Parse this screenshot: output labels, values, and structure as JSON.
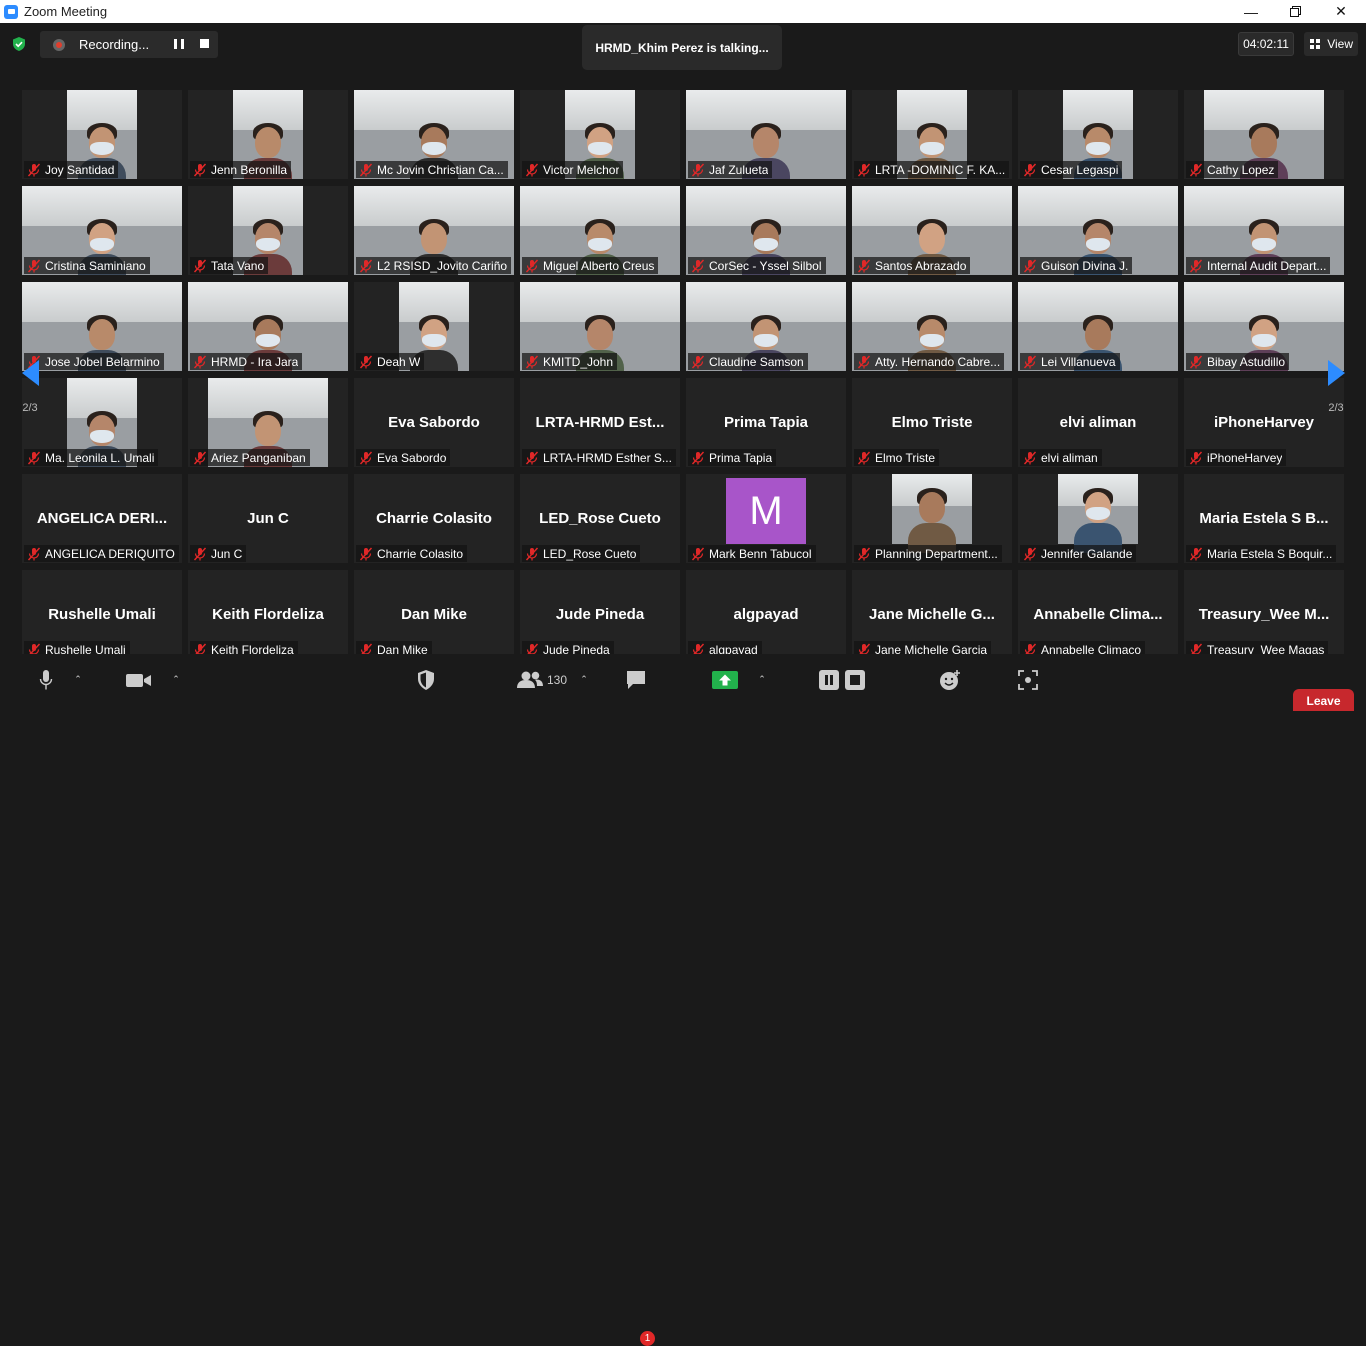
{
  "window": {
    "title": "Zoom Meeting"
  },
  "recording": {
    "label": "Recording..."
  },
  "talking": {
    "text": "HRMD_Khim Perez is talking..."
  },
  "timer": {
    "value": "04:02:11"
  },
  "view": {
    "label": "View"
  },
  "pages": {
    "left": "2/3",
    "right": "2/3"
  },
  "participants_count": "130",
  "chat_badge": "1",
  "leave_label": "Leave",
  "colors": {
    "muted_red": "#e02828",
    "accent_green": "#22b14c",
    "leave_red": "#c7282d",
    "avatar_purple": "#a855c9"
  },
  "tiles": [
    {
      "name": "Joy Santidad",
      "kind": "video",
      "vx": 45,
      "vw": 70
    },
    {
      "name": "Jenn Beronilla",
      "kind": "video",
      "vx": 45,
      "vw": 70
    },
    {
      "name": "Mc Jovin Christian Ca...",
      "kind": "video",
      "vx": 0,
      "vw": 160
    },
    {
      "name": "Victor Melchor",
      "kind": "video",
      "vx": 45,
      "vw": 70
    },
    {
      "name": "Jaf Zulueta",
      "kind": "video",
      "vx": 0,
      "vw": 160
    },
    {
      "name": "LRTA -DOMINIC F. KA...",
      "kind": "video",
      "vx": 45,
      "vw": 70
    },
    {
      "name": "Cesar Legaspi",
      "kind": "video",
      "vx": 45,
      "vw": 70
    },
    {
      "name": "Cathy Lopez",
      "kind": "video",
      "vx": 20,
      "vw": 120
    },
    {
      "name": "Cristina Saminiano",
      "kind": "video",
      "vx": 0,
      "vw": 160
    },
    {
      "name": "Tata Vano",
      "kind": "video",
      "vx": 45,
      "vw": 70
    },
    {
      "name": "L2 RSISD_Jovito Cariño",
      "kind": "video",
      "vx": 0,
      "vw": 160
    },
    {
      "name": "Miguel Alberto Creus",
      "kind": "video",
      "vx": 0,
      "vw": 160
    },
    {
      "name": "CorSec - Yssel Silbol",
      "kind": "video",
      "vx": 0,
      "vw": 160
    },
    {
      "name": "Santos Abrazado",
      "kind": "video",
      "vx": 0,
      "vw": 160
    },
    {
      "name": "Guison Divina J.",
      "kind": "video",
      "vx": 0,
      "vw": 160
    },
    {
      "name": "Internal Audit Depart...",
      "kind": "video",
      "vx": 0,
      "vw": 160
    },
    {
      "name": "Jose Jobel Belarmino",
      "kind": "video",
      "vx": 0,
      "vw": 160
    },
    {
      "name": "HRMD - Ira Jara",
      "kind": "video",
      "vx": 0,
      "vw": 160
    },
    {
      "name": "Deah W",
      "kind": "video",
      "vx": 45,
      "vw": 70
    },
    {
      "name": "KMITD_John",
      "kind": "video",
      "vx": 0,
      "vw": 160
    },
    {
      "name": "Claudine Samson",
      "kind": "video",
      "vx": 0,
      "vw": 160
    },
    {
      "name": "Atty. Hernando Cabre...",
      "kind": "video",
      "vx": 0,
      "vw": 160
    },
    {
      "name": "Lei Villanueva",
      "kind": "video",
      "vx": 0,
      "vw": 160
    },
    {
      "name": "Bibay Astudillo",
      "kind": "video",
      "vx": 0,
      "vw": 160
    },
    {
      "name": "Ma. Leonila L. Umali",
      "kind": "video",
      "vx": 45,
      "vw": 70
    },
    {
      "name": "Ariez Panganiban",
      "kind": "video",
      "vx": 20,
      "vw": 120
    },
    {
      "name": "Eva Sabordo",
      "big": "Eva Sabordo",
      "kind": "name"
    },
    {
      "name": "LRTA-HRMD Esther S...",
      "big": "LRTA-HRMD Est...",
      "kind": "name"
    },
    {
      "name": "Prima Tapia",
      "big": "Prima Tapia",
      "kind": "name"
    },
    {
      "name": "Elmo Triste",
      "big": "Elmo Triste",
      "kind": "name"
    },
    {
      "name": "elvi aliman",
      "big": "elvi aliman",
      "kind": "name"
    },
    {
      "name": "iPhoneHarvey",
      "big": "iPhoneHarvey",
      "kind": "name"
    },
    {
      "name": "ANGELICA DERIQUITO",
      "big": "ANGELICA DERI...",
      "kind": "name"
    },
    {
      "name": "Jun C",
      "big": "Jun C",
      "kind": "name"
    },
    {
      "name": "Charrie Colasito",
      "big": "Charrie Colasito",
      "kind": "name"
    },
    {
      "name": "LED_Rose Cueto",
      "big": "LED_Rose Cueto",
      "kind": "name"
    },
    {
      "name": "Mark Benn Tabucol",
      "kind": "avatar",
      "letter": "M"
    },
    {
      "name": "Planning Department...",
      "kind": "photo",
      "vx": 40,
      "vw": 80
    },
    {
      "name": "Jennifer Galande",
      "kind": "photo",
      "vx": 40,
      "vw": 80
    },
    {
      "name": "Maria Estela S Boquir...",
      "big": "Maria Estela S B...",
      "kind": "name"
    },
    {
      "name": "Rushelle Umali",
      "big": "Rushelle Umali",
      "kind": "name"
    },
    {
      "name": "Keith Flordeliza",
      "big": "Keith Flordeliza",
      "kind": "name"
    },
    {
      "name": "Dan Mike",
      "big": "Dan Mike",
      "kind": "name"
    },
    {
      "name": "Jude Pineda",
      "big": "Jude Pineda",
      "kind": "name"
    },
    {
      "name": "algpayad",
      "big": "algpayad",
      "kind": "name"
    },
    {
      "name": "Jane Michelle Garcia",
      "big": "Jane Michelle G...",
      "kind": "name"
    },
    {
      "name": "Annabelle Climaco",
      "big": "Annabelle Clima...",
      "kind": "name"
    },
    {
      "name": "Treasury_Wee Magas",
      "big": "Treasury_Wee M...",
      "kind": "name"
    }
  ]
}
